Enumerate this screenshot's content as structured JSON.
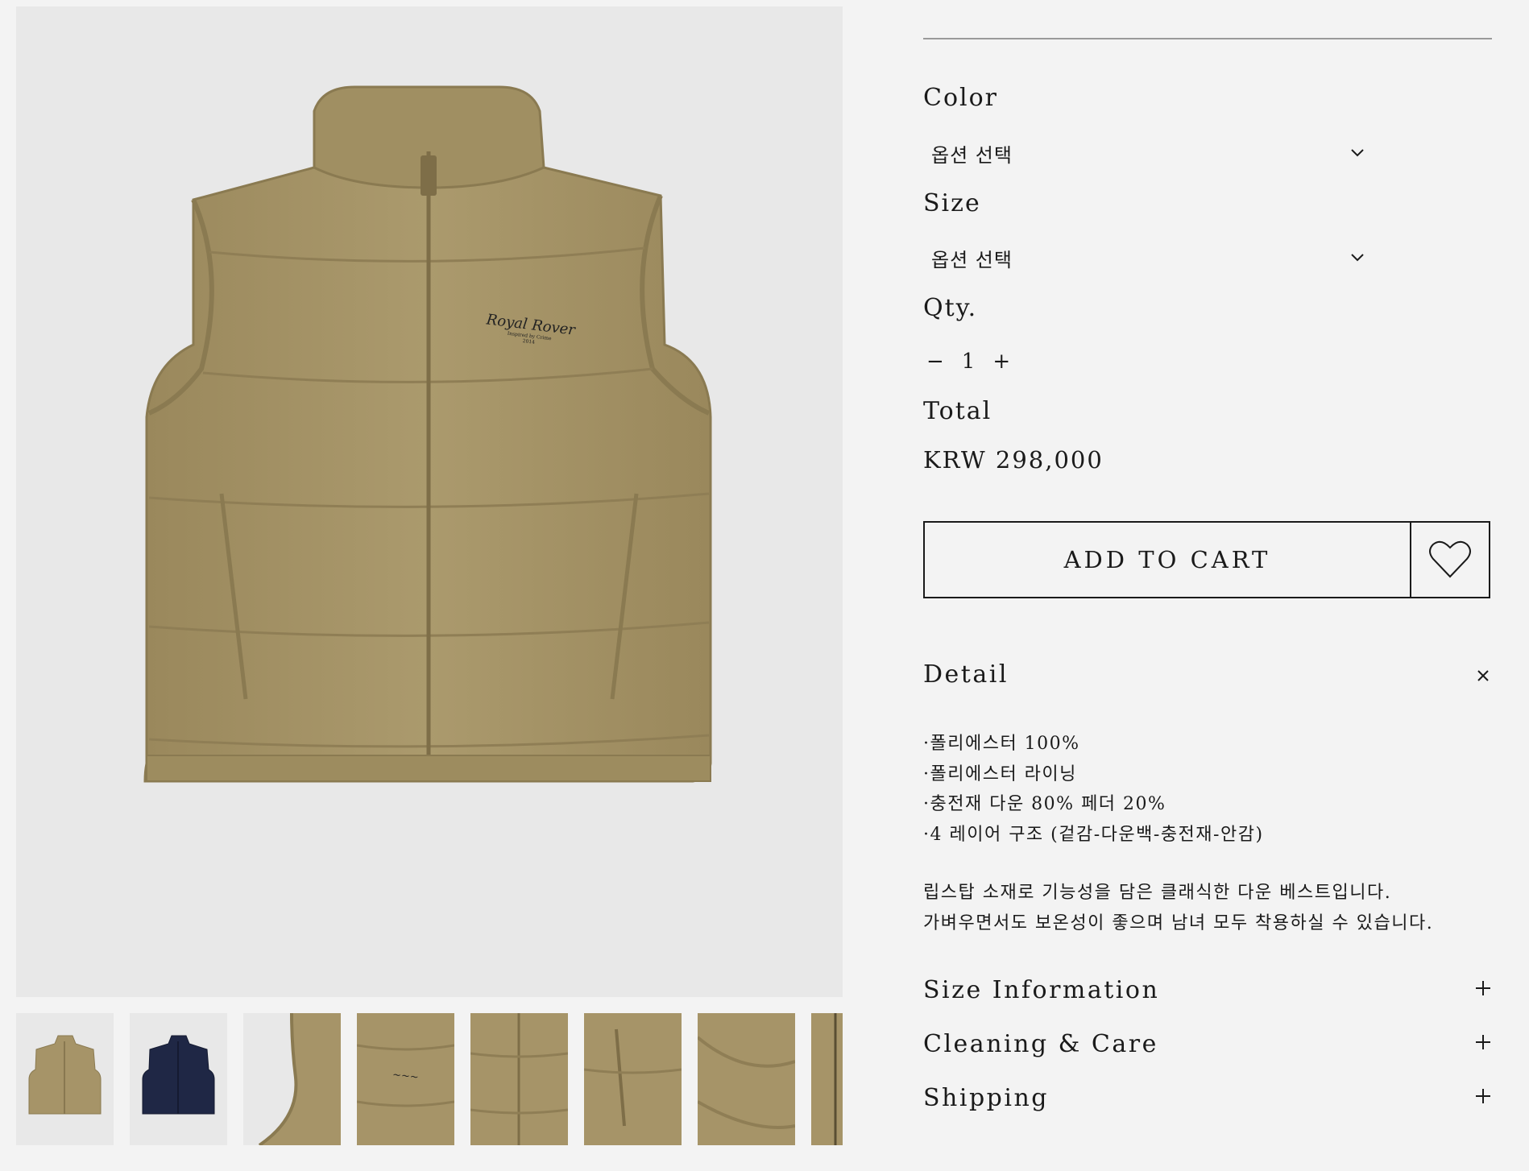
{
  "gallery": {
    "main_image": "khaki-down-vest-front",
    "thumbnails": [
      {
        "name": "khaki-vest-front",
        "color": "#a69468"
      },
      {
        "name": "navy-vest-front",
        "color": "#1f2745"
      },
      {
        "name": "shoulder-detail",
        "color": "#a69468"
      },
      {
        "name": "logo-embroidery-detail",
        "color": "#a69468"
      },
      {
        "name": "zipper-detail",
        "color": "#a69468"
      },
      {
        "name": "pocket-detail",
        "color": "#a69468"
      },
      {
        "name": "fabric-detail",
        "color": "#a69468"
      },
      {
        "name": "partial-detail",
        "color": "#a69468"
      }
    ]
  },
  "logo": {
    "text": "Royal Rover",
    "sub1": "Inspired by Crime",
    "sub2": "2014"
  },
  "options": {
    "color_label": "Color",
    "color_value": "옵션 선택",
    "size_label": "Size",
    "size_value": "옵션 선택",
    "qty_label": "Qty.",
    "qty_minus": "−",
    "qty_value": "1",
    "qty_plus": "+",
    "total_label": "Total",
    "total_price": "KRW 298,000"
  },
  "actions": {
    "add_to_cart": "ADD TO CART",
    "wishlist_icon": "heart-icon"
  },
  "detail": {
    "title": "Detail",
    "lines": [
      "·폴리에스터 100%",
      "·폴리에스터 라이닝",
      "·충전재 다운 80% 페더 20%",
      "·4 레이어 구조 (겉감-다운백-충전재-안감)"
    ],
    "desc_line1": "립스탑 소재로 기능성을 담은 클래식한 다운 베스트입니다.",
    "desc_line2": "가벼우면서도 보온성이 좋으며 남녀 모두 착용하실 수 있습니다."
  },
  "accordions": {
    "size_info": "Size Information",
    "cleaning": "Cleaning & Care",
    "shipping": "Shipping"
  },
  "colors": {
    "vest": "#a69468",
    "vest_shadow": "#8f7e55",
    "navy": "#1f2745",
    "bg": "#f3f3f3"
  }
}
